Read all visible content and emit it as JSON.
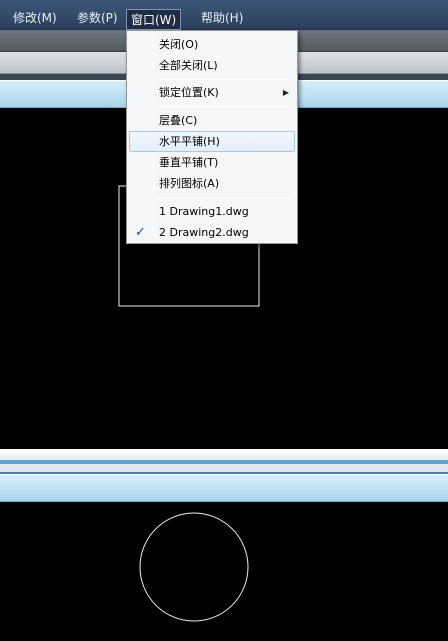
{
  "menubar": {
    "items": [
      {
        "label": "修改(M)"
      },
      {
        "label": "参数(P)"
      },
      {
        "label": "窗口(W)"
      },
      {
        "label": "帮助(H)"
      }
    ]
  },
  "window_menu": {
    "items": [
      {
        "label": "关闭(O)"
      },
      {
        "label": "全部关闭(L)"
      },
      {
        "label": "锁定位置(K)",
        "submenu_glyph": "▶"
      },
      {
        "label": "层叠(C)"
      },
      {
        "label": "水平平铺(H)"
      },
      {
        "label": "垂直平铺(T)"
      },
      {
        "label": "排列图标(A)"
      },
      {
        "label": "1 Drawing1.dwg"
      },
      {
        "label": "2 Drawing2.dwg",
        "check_glyph": "✓"
      }
    ]
  },
  "colors": {
    "canvas": "#000000",
    "drawing_stroke": "#ffffff",
    "check": "#1f4fa8"
  }
}
